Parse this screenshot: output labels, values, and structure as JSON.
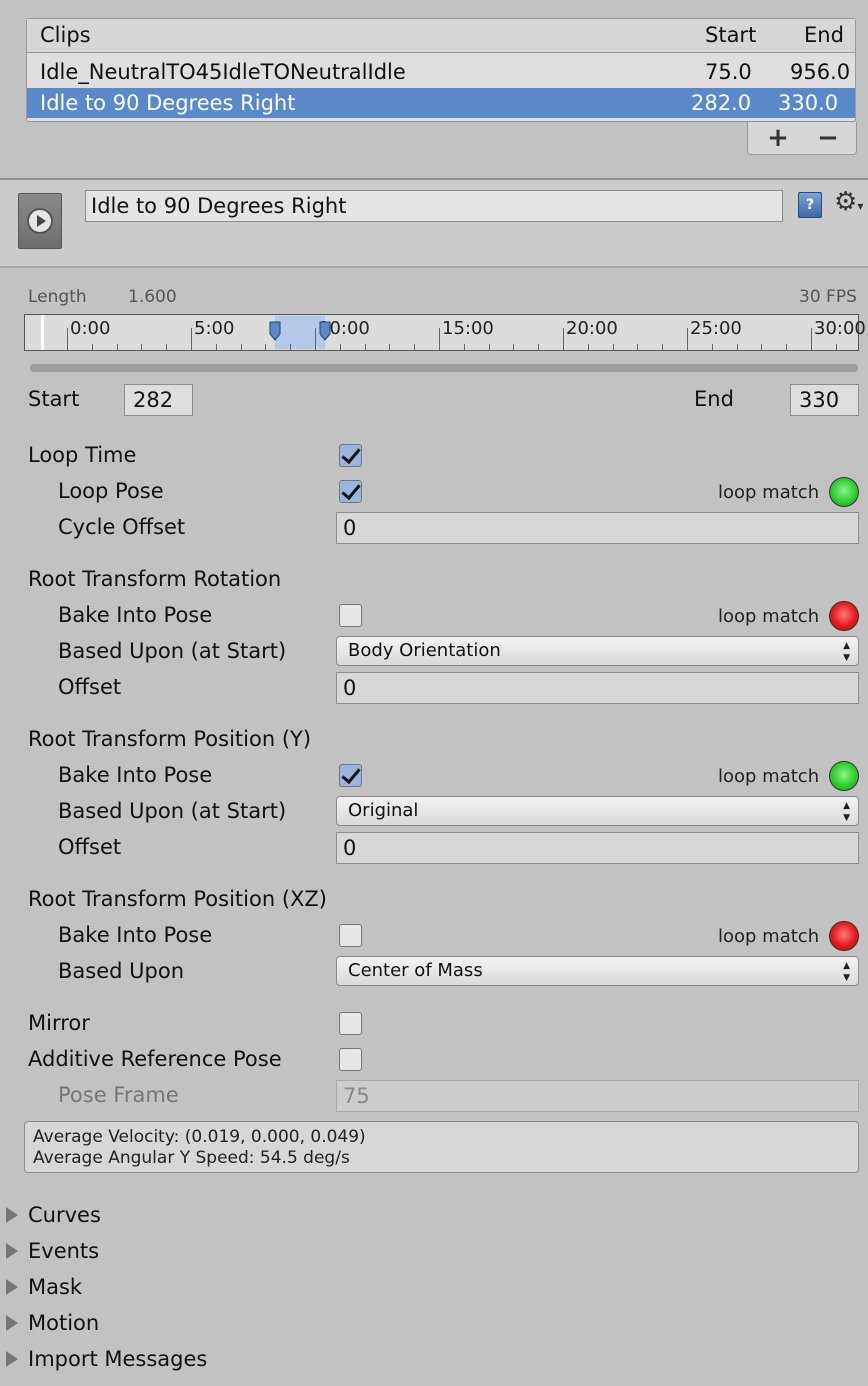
{
  "clips": {
    "header": {
      "name": "Clips",
      "start": "Start",
      "end": "End"
    },
    "rows": [
      {
        "name": "Idle_NeutralTO45IdleTONeutralIdle",
        "start": "75.0",
        "end": "956.0",
        "selected": false
      },
      {
        "name": "Idle to 90 Degrees Right",
        "start": "282.0",
        "end": "330.0",
        "selected": true
      }
    ],
    "add_label": "+",
    "remove_label": "−"
  },
  "clip_header": {
    "name_value": "Idle to 90 Degrees Right",
    "help_icon": "book-help-icon",
    "settings_icon": "gear-icon"
  },
  "timeline": {
    "length_label": "Length",
    "length_value": "1.600",
    "fps_label": "30 FPS",
    "ticks": [
      "0:00",
      "5:00",
      "10:00",
      "15:00",
      "20:00",
      "25:00",
      "30:00"
    ],
    "range_start_frame": 282,
    "range_end_frame": 330
  },
  "range": {
    "start_label": "Start",
    "start_value": "282",
    "end_label": "End",
    "end_value": "330"
  },
  "loop": {
    "loop_time_label": "Loop Time",
    "loop_time_checked": true,
    "loop_pose_label": "Loop Pose",
    "loop_pose_checked": true,
    "loop_pose_match": "loop match",
    "cycle_offset_label": "Cycle Offset",
    "cycle_offset_value": "0"
  },
  "rotation": {
    "title": "Root Transform Rotation",
    "bake_label": "Bake Into Pose",
    "bake_checked": false,
    "match_label": "loop match",
    "based_upon_label": "Based Upon (at Start)",
    "based_upon_value": "Body Orientation",
    "offset_label": "Offset",
    "offset_value": "0"
  },
  "position_y": {
    "title": "Root Transform Position (Y)",
    "bake_label": "Bake Into Pose",
    "bake_checked": true,
    "match_label": "loop match",
    "based_upon_label": "Based Upon (at Start)",
    "based_upon_value": "Original",
    "offset_label": "Offset",
    "offset_value": "0"
  },
  "position_xz": {
    "title": "Root Transform Position (XZ)",
    "bake_label": "Bake Into Pose",
    "bake_checked": false,
    "match_label": "loop match",
    "based_upon_label": "Based Upon",
    "based_upon_value": "Center of Mass"
  },
  "misc": {
    "mirror_label": "Mirror",
    "mirror_checked": false,
    "additive_label": "Additive Reference Pose",
    "additive_checked": false,
    "pose_frame_label": "Pose Frame",
    "pose_frame_value": "75"
  },
  "info": {
    "velocity": "Average Velocity: (0.019, 0.000, 0.049)",
    "angular": "Average Angular Y Speed: 54.5 deg/s"
  },
  "foldouts": [
    "Curves",
    "Events",
    "Mask",
    "Motion",
    "Import Messages"
  ],
  "colors": {
    "selection": "#5b88c9",
    "match_green": "#2fcd2f",
    "match_red": "#e41b1b"
  }
}
